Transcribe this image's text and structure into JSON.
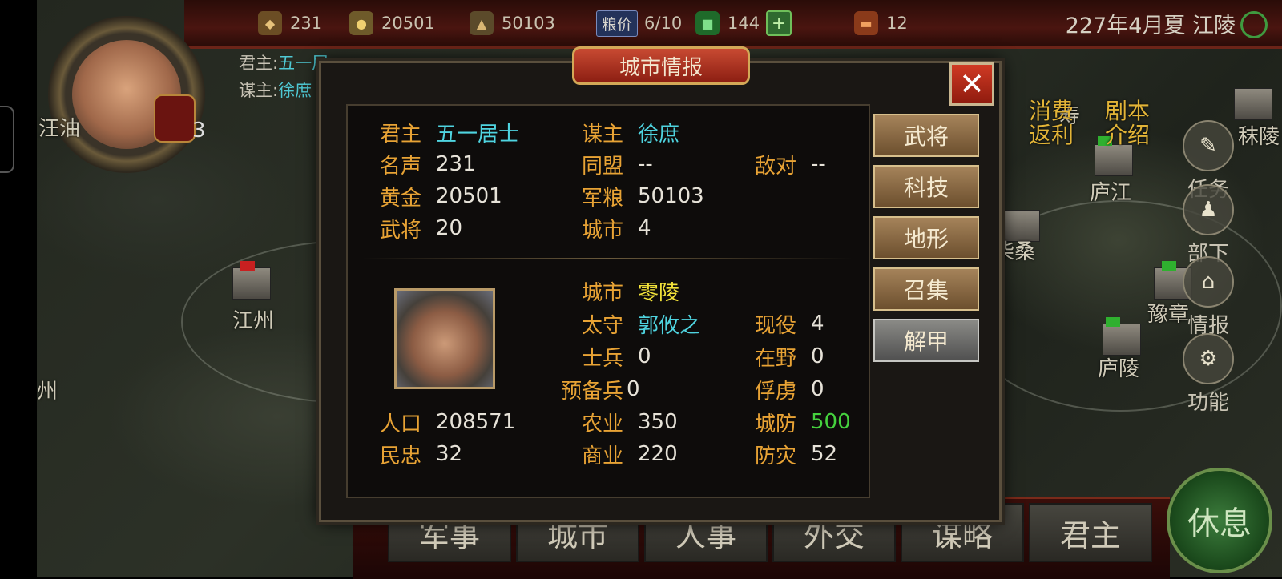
{
  "topbar": {
    "fame": "231",
    "gold": "20501",
    "grain": "50103",
    "grain_price_label": "粮价",
    "grain_price_value": "6/10",
    "jade": "144",
    "scroll_count": "12",
    "date_location": "227年4月夏 江陵"
  },
  "lord_panel": {
    "lord_label": "君主:",
    "lord_value": "五一居",
    "strategist_label": "谋主:",
    "strategist_value": "徐庶",
    "badge_count": "3"
  },
  "map_labels": {
    "left_top": "汪油",
    "jiangzhou": "江州",
    "left_bottom": "州",
    "shou": "寿",
    "moling": "秣陵",
    "lujiang": "庐江",
    "chaisang": "柴桑",
    "yuzhang": "豫章",
    "luling": "庐陵"
  },
  "promos": {
    "consume_rebate": "消费返利",
    "script_intro": "剧本介绍"
  },
  "side_menu": {
    "task": "任务",
    "subordinates": "部下",
    "intel": "情报",
    "function": "功能"
  },
  "dialog": {
    "title": "城市情报",
    "close_symbol": "✕",
    "faction": {
      "lord_label": "君主",
      "lord_value": "五一居士",
      "strategist_label": "谋主",
      "strategist_value": "徐庶",
      "fame_label": "名声",
      "fame_value": "231",
      "alliance_label": "同盟",
      "alliance_value": "--",
      "hostile_label": "敌对",
      "hostile_value": "--",
      "gold_label": "黄金",
      "gold_value": "20501",
      "grain_label": "军粮",
      "grain_value": "50103",
      "generals_label": "武将",
      "generals_value": "20",
      "cities_label": "城市",
      "cities_value": "4"
    },
    "city": {
      "city_label": "城市",
      "city_value": "零陵",
      "governor_label": "太守",
      "governor_value": "郭攸之",
      "active_label": "现役",
      "active_value": "4",
      "soldiers_label": "士兵",
      "soldiers_value": "0",
      "wild_label": "在野",
      "wild_value": "0",
      "reserve_label": "预备兵",
      "reserve_value": "0",
      "captive_label": "俘虏",
      "captive_value": "0",
      "population_label": "人口",
      "population_value": "208571",
      "agri_label": "农业",
      "agri_value": "350",
      "defense_label": "城防",
      "defense_value": "500",
      "loyalty_label": "民忠",
      "loyalty_value": "32",
      "commerce_label": "商业",
      "commerce_value": "220",
      "disaster_label": "防灾",
      "disaster_value": "52"
    },
    "actions": [
      "武将",
      "科技",
      "地形",
      "召集",
      "解甲"
    ]
  },
  "bottom_tabs": [
    "军事",
    "城市",
    "人事",
    "外交",
    "谋略",
    "君主"
  ],
  "rest_button": "休息",
  "colors": {
    "label": "#e8a335",
    "cyan_value": "#4fd4e0",
    "yellow_value": "#f2e23a",
    "green_value": "#45d13e"
  }
}
